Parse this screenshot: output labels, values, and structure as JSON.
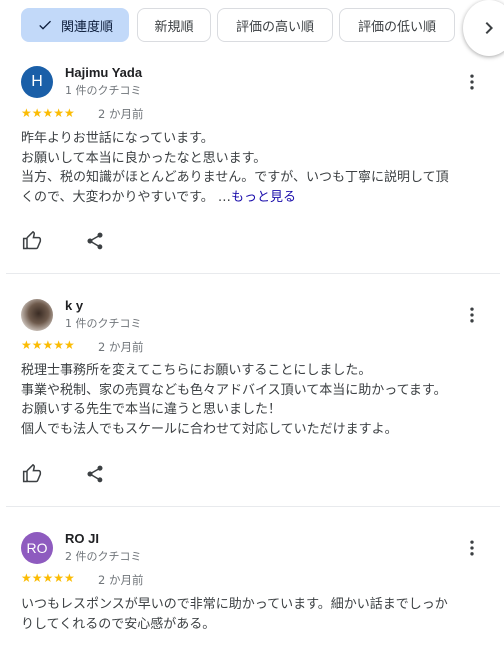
{
  "sort": {
    "chips": [
      {
        "label": "関連度順",
        "selected": true
      },
      {
        "label": "新規順",
        "selected": false
      },
      {
        "label": "評価の高い順",
        "selected": false
      },
      {
        "label": "評価の低い順",
        "selected": false
      }
    ]
  },
  "reviews": [
    {
      "avatar_letter": "H",
      "avatar_color": "#1a5fa8",
      "name": "Hajimu Yada",
      "review_count": "1 件のクチコミ",
      "stars": "★★★★★",
      "date": "2 か月前",
      "lines": [
        "昨年よりお世話になっています。",
        "お願いして本当に良かったなと思います。",
        "当方、税の知識がほとんどありません。ですが、いつも丁寧に説明して頂",
        "くので、大変わかりやすいです。 …"
      ],
      "more_link": "もっと見る"
    },
    {
      "avatar_letter": "",
      "avatar_color": "#5b4a3f",
      "name": "k y",
      "review_count": "1 件のクチコミ",
      "stars": "★★★★★",
      "date": "2 か月前",
      "lines": [
        "税理士事務所を変えてこちらにお願いすることにしました。",
        "事業や税制、家の売買なども色々アドバイス頂いて本当に助かってます。",
        "お願いする先生で本当に違うと思いました！",
        "個人でも法人でもスケールに合わせて対応していただけますよ。"
      ]
    },
    {
      "avatar_letter": "RO",
      "avatar_color": "#8e5bbf",
      "name": "RO JI",
      "review_count": "2 件のクチコミ",
      "stars": "★★★★★",
      "date": "2 か月前",
      "lines": [
        "いつもレスポンスが早いので非常に助かっています。細かい話までしっか",
        "りしてくれるので安心感がある。"
      ]
    }
  ]
}
